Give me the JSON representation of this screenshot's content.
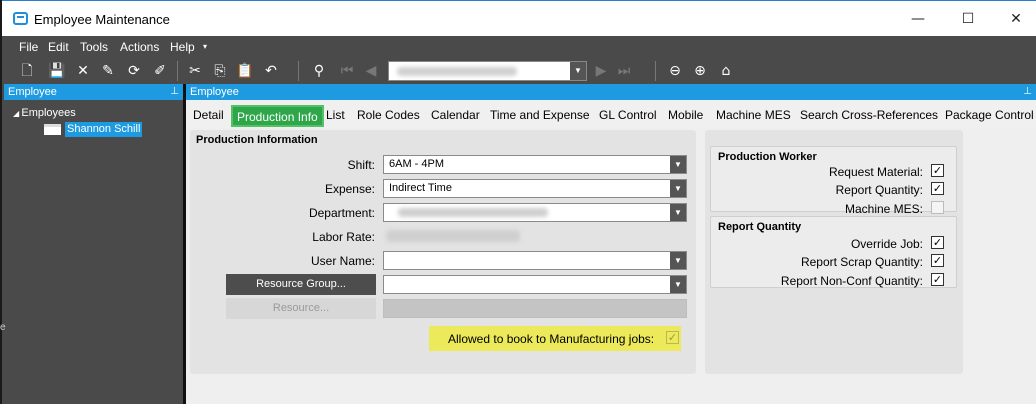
{
  "window": {
    "title": "Employee Maintenance",
    "minimize": "—",
    "maximize": "☐",
    "close": "✕"
  },
  "menu": [
    "File",
    "Edit",
    "Tools",
    "Actions",
    "Help"
  ],
  "left_panel": {
    "header": "Employee",
    "tree_root": "Employees",
    "selected_employee": "Shannon Schill"
  },
  "right_panel": {
    "header": "Employee"
  },
  "tabs": [
    "Detail",
    "Production Info",
    "List",
    "Role Codes",
    "Calendar",
    "Time and Expense",
    "GL Control",
    "Mobile",
    "Machine MES",
    "Search Cross-References",
    "Package Control"
  ],
  "active_tab": "Production Info",
  "production_info": {
    "title": "Production Information",
    "shift_label": "Shift:",
    "shift_value": "6AM - 4PM",
    "expense_label": "Expense:",
    "expense_value": "Indirect Time",
    "department_label": "Department:",
    "labor_rate_label": "Labor Rate:",
    "user_name_label": "User Name:",
    "resource_group_button": "Resource Group...",
    "resource_button": "Resource...",
    "manufacturing_label": "Allowed to book to Manufacturing jobs:",
    "manufacturing_checked": true
  },
  "production_worker": {
    "title": "Production Worker",
    "request_material": "Request Material:",
    "request_material_checked": true,
    "report_quantity": "Report Quantity:",
    "report_quantity_checked": true,
    "machine_mes": "Machine MES:",
    "machine_mes_checked": false
  },
  "report_quantity": {
    "title": "Report Quantity",
    "override_job": "Override Job:",
    "override_job_checked": true,
    "report_scrap": "Report Scrap Quantity:",
    "report_scrap_checked": true,
    "report_nonconf": "Report Non-Conf Quantity:",
    "report_nonconf_checked": true
  },
  "colors": {
    "accent": "#1e9be0",
    "active_tab": "#2ea64a",
    "highlight": "#ece95a",
    "chrome": "#4a4a4a"
  }
}
